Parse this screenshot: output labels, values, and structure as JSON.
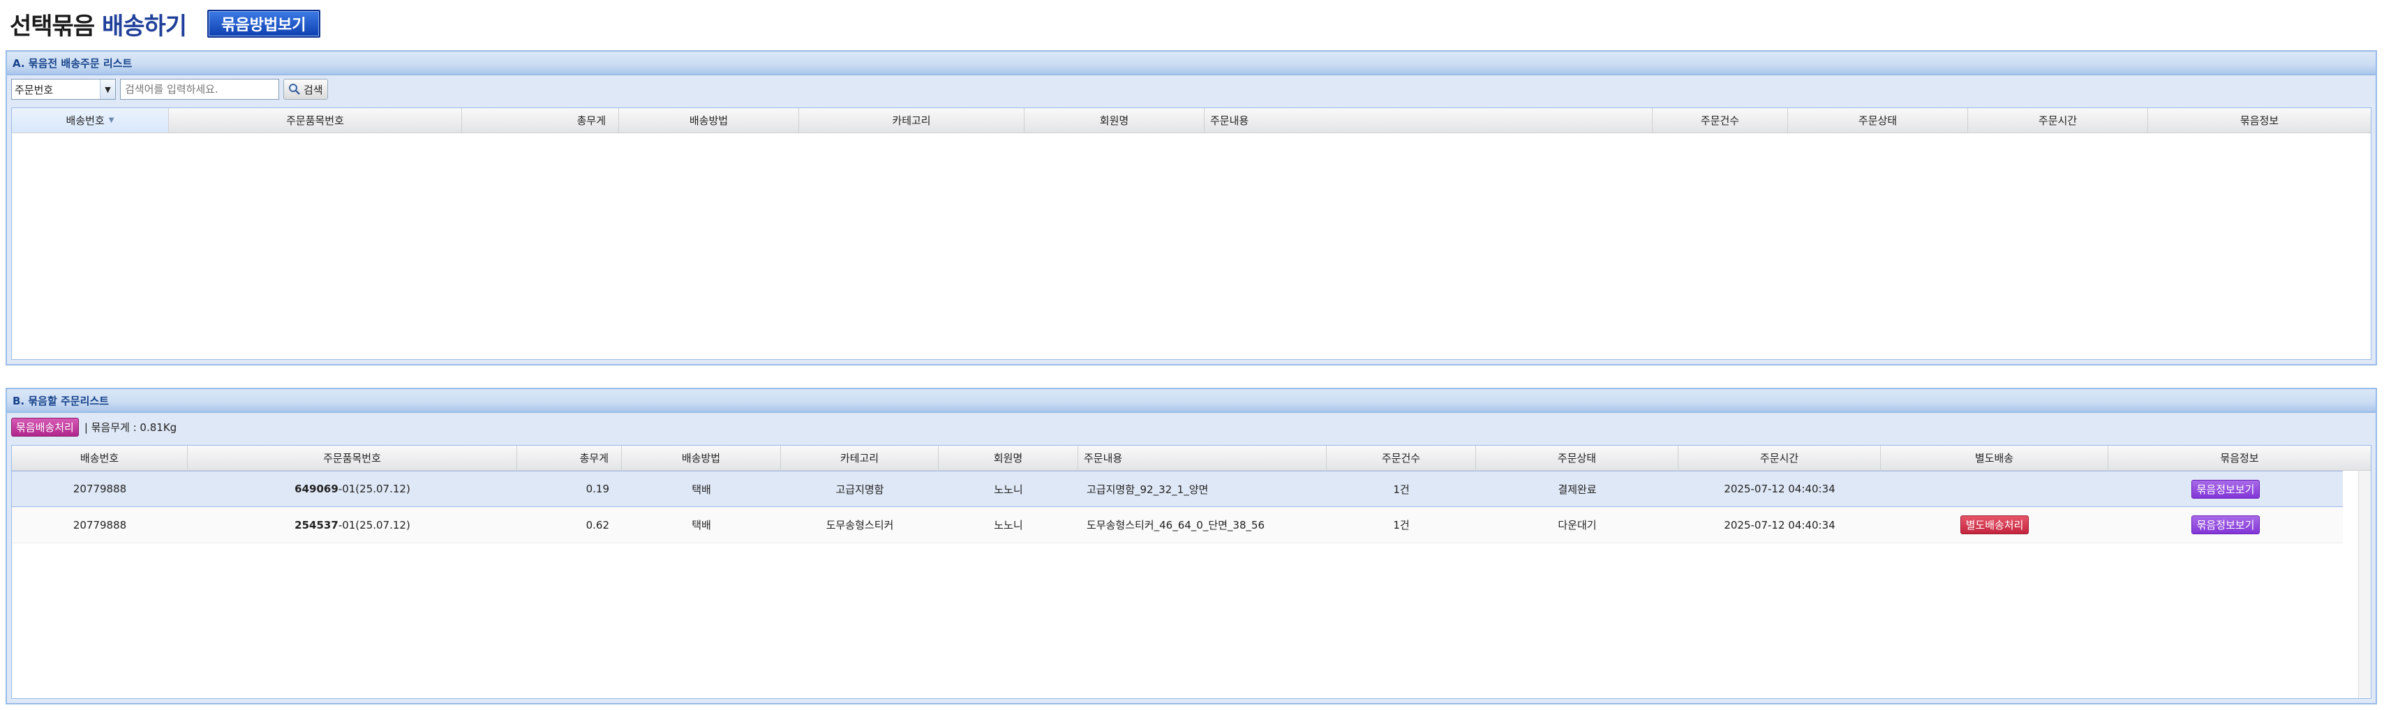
{
  "header": {
    "title_part1": "선택묶음",
    "title_part2": "배송하기",
    "guide_button": "묶음방법보기"
  },
  "panel_a": {
    "title": "A. 묶음전 배송주문 리스트",
    "search_select": "주문번호",
    "search_placeholder": "검색어를 입력하세요.",
    "search_button": "검색",
    "columns": [
      "배송번호",
      "주문품목번호",
      "총무게",
      "배송방법",
      "카테고리",
      "회원명",
      "주문내용",
      "주문건수",
      "주문상태",
      "주문시간",
      "묶음정보"
    ],
    "rows": []
  },
  "panel_b": {
    "title": "B. 묶음할 주문리스트",
    "bundle_button": "묶음배송처리",
    "weight_text": "| 묶음무게 : 0.81Kg",
    "columns": [
      "배송번호",
      "주문품목번호",
      "총무게",
      "배송방법",
      "카테고리",
      "회원명",
      "주문내용",
      "주문건수",
      "주문상태",
      "주문시간",
      "별도배송",
      "묶음정보"
    ],
    "rows": [
      {
        "ship_no": "20779888",
        "item_no_bold": "649069",
        "item_no_rest": "-01(25.07.12)",
        "weight": "0.19",
        "method": "택배",
        "category": "고급지명함",
        "member": "노노니",
        "content": "고급지명함_92_32_1_양면",
        "count": "1건",
        "status": "결제완료",
        "time": "2025-07-12 04:40:34",
        "separate": "",
        "info_button": "묶음정보보기"
      },
      {
        "ship_no": "20779888",
        "item_no_bold": "254537",
        "item_no_rest": "-01(25.07.12)",
        "weight": "0.62",
        "method": "택배",
        "category": "도무송형스티커",
        "member": "노노니",
        "content": "도무송형스티커_46_64_0_단면_38_56",
        "count": "1건",
        "status": "다운대기",
        "time": "2025-07-12 04:40:34",
        "separate": "별도배송처리",
        "info_button": "묶음정보보기"
      }
    ]
  }
}
